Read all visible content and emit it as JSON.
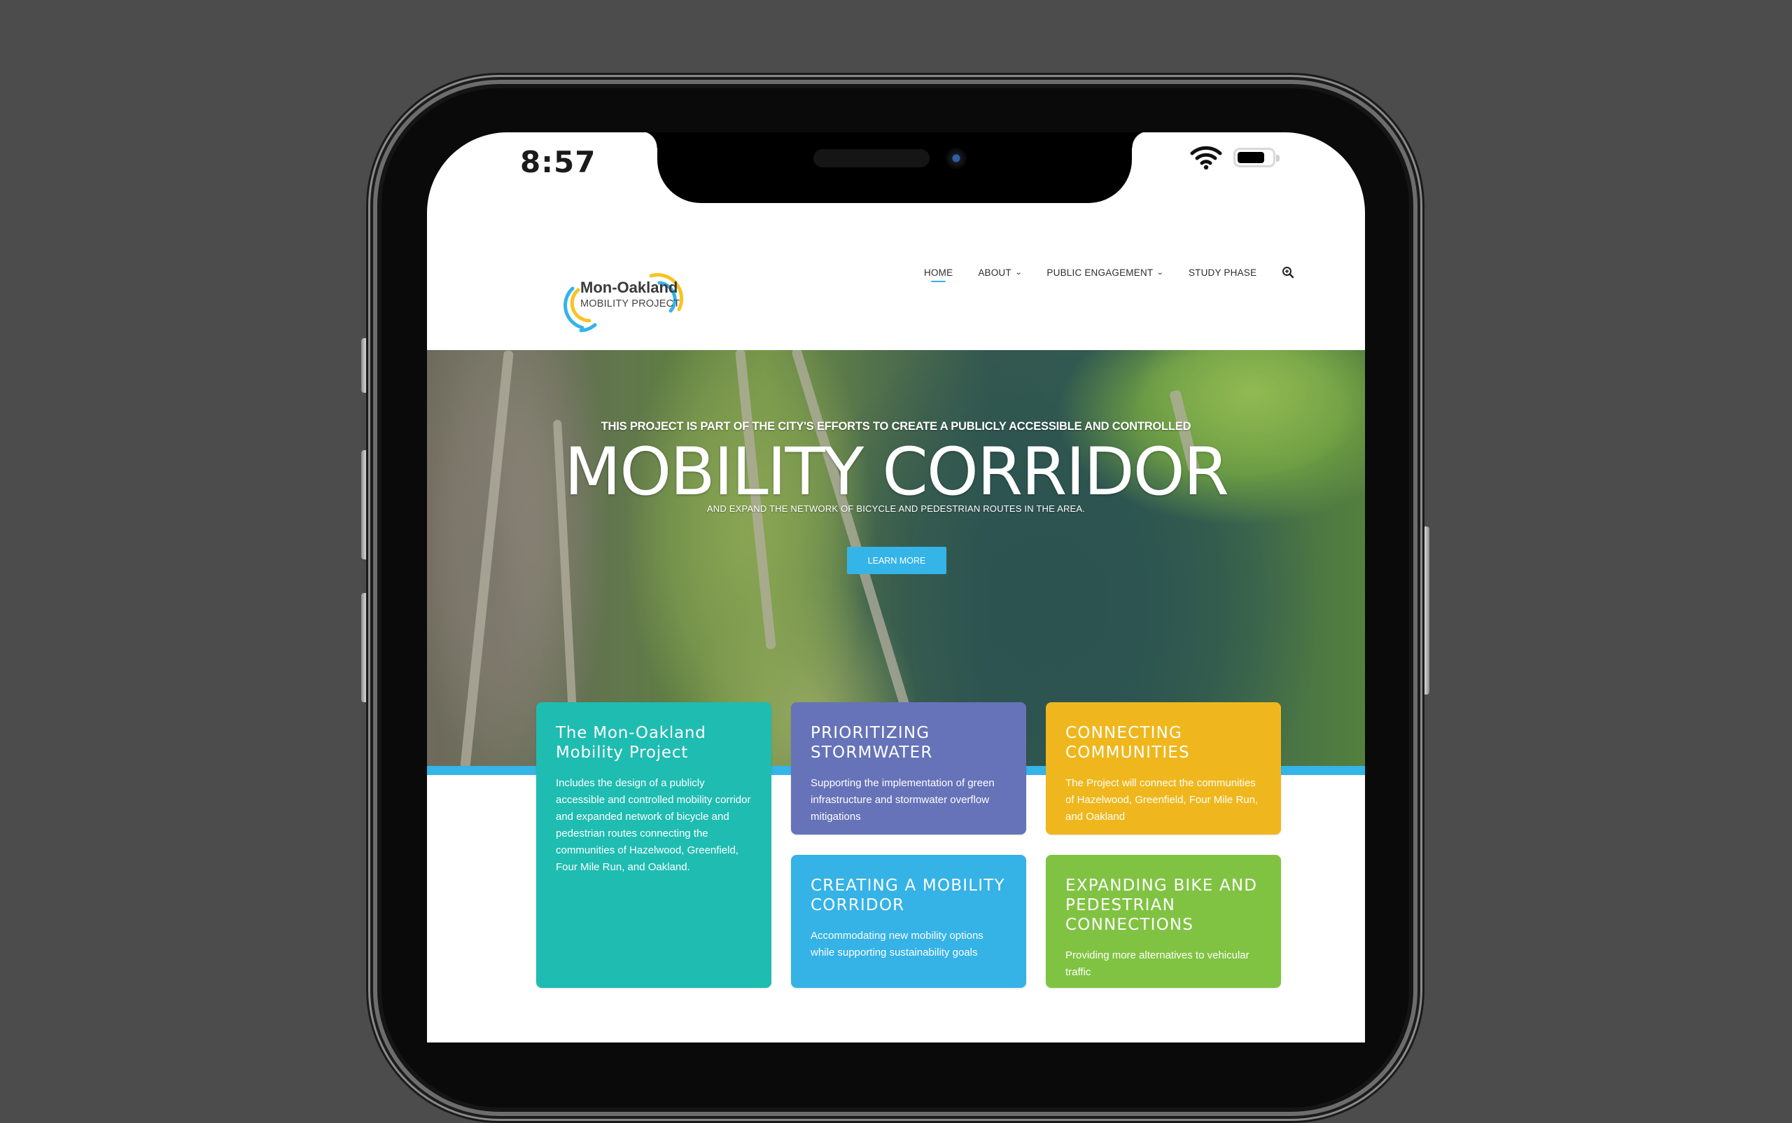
{
  "device": {
    "status_bar": {
      "time": "8:57",
      "wifi_icon": "wifi-icon",
      "battery_icon": "battery-icon",
      "battery_level_percent": 80
    }
  },
  "site": {
    "logo": {
      "line1": "Mon-Oakland",
      "line2": "MOBILITY PROJECT",
      "colors": {
        "blue": "#35b4e8",
        "yellow": "#f7c325"
      }
    },
    "nav": {
      "items": [
        {
          "label": "HOME",
          "active": true,
          "has_dropdown": false
        },
        {
          "label": "ABOUT",
          "active": false,
          "has_dropdown": true
        },
        {
          "label": "PUBLIC ENGAGEMENT",
          "active": false,
          "has_dropdown": true
        },
        {
          "label": "STUDY PHASE",
          "active": false,
          "has_dropdown": false
        }
      ],
      "chevron": "⌄",
      "search_icon": "zoom-in-search-icon",
      "accent_color": "#32b2e6"
    },
    "hero": {
      "subtitle_top": "THIS PROJECT IS PART OF THE CITY'S EFFORTS TO CREATE A PUBLICLY ACCESSIBLE AND CONTROLLED",
      "title": "MOBILITY CORRIDOR",
      "subtitle_bottom": "AND EXPAND THE NETWORK OF BICYCLE AND PEDESTRIAN ROUTES IN THE AREA.",
      "button_label": "LEARN MORE",
      "button_color": "#35b4e8",
      "background": "aerial photo of neighborhood, trails and forest"
    },
    "cards": [
      {
        "title": "The Mon-Oakland Mobility Project",
        "text": "Includes the design of a publicly accessible and controlled mobility corridor and expanded network of bicycle and pedestrian routes connecting the communities of Hazelwood, Greenfield, Four Mile Run, and Oakland.",
        "color": "#1fbcb1"
      },
      {
        "title": "PRIORITIZING STORMWATER",
        "text": "Supporting the implementation of green infrastructure and stormwater overflow mitigations",
        "color": "#6673b9"
      },
      {
        "title": "CONNECTING COMMUNITIES",
        "text": "The Project will connect the communities of Hazelwood, Greenfield, Four Mile Run, and Oakland",
        "color": "#efb71d"
      },
      {
        "title": "CREATING A MOBILITY CORRIDOR",
        "text": "Accommodating new mobility options while supporting sustainability goals",
        "color": "#35b2e6"
      },
      {
        "title": "EXPANDING BIKE AND PEDESTRIAN CONNECTIONS",
        "text": "Providing more alternatives to vehicular traffic",
        "color": "#80c342"
      }
    ]
  }
}
